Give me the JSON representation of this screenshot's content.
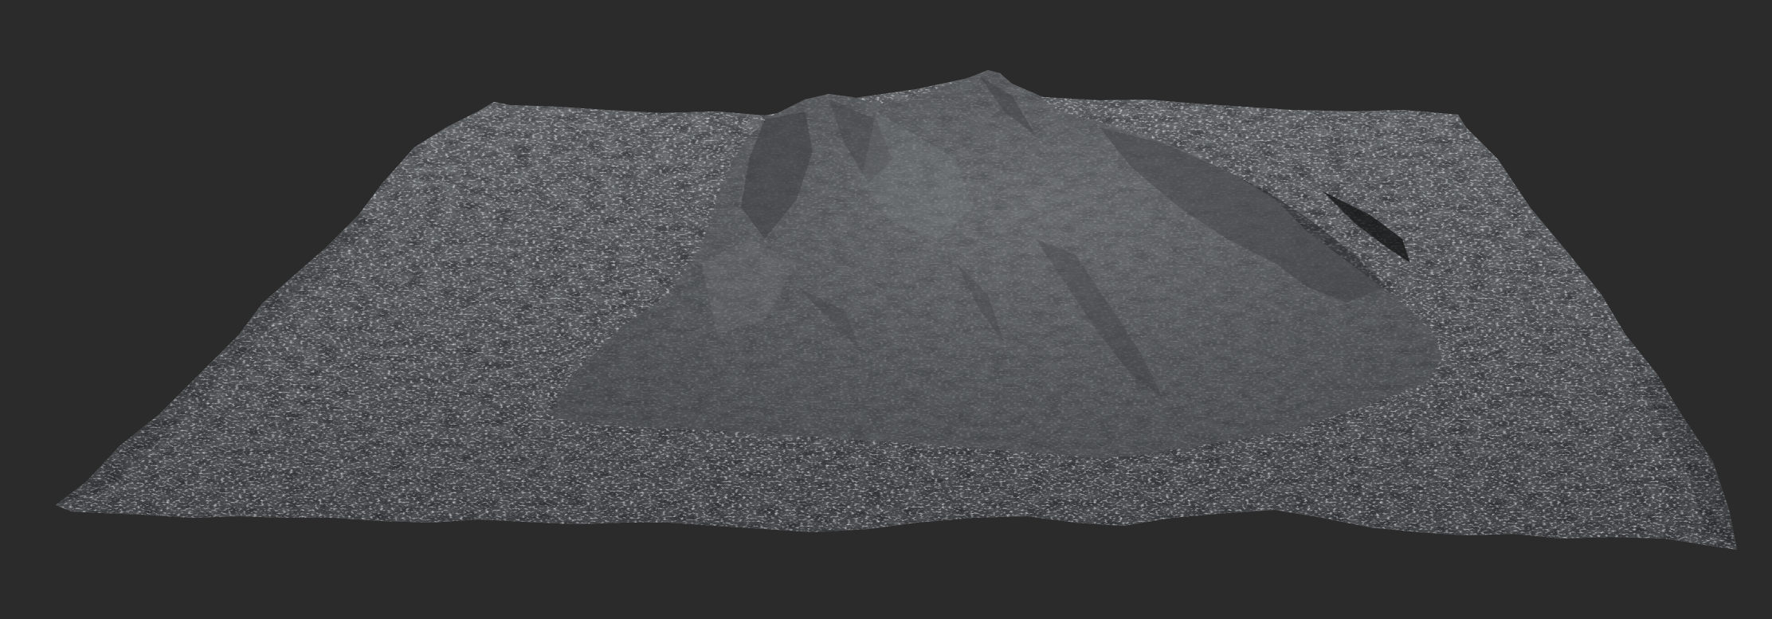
{
  "scene": {
    "background_color": "#2b2b2b",
    "subject": "terrain-mesh",
    "terrain_colors": {
      "base": "#5a5c5e",
      "dark": "#2e3032",
      "light": "#8a8d90",
      "shadow": "#1f2022"
    }
  }
}
